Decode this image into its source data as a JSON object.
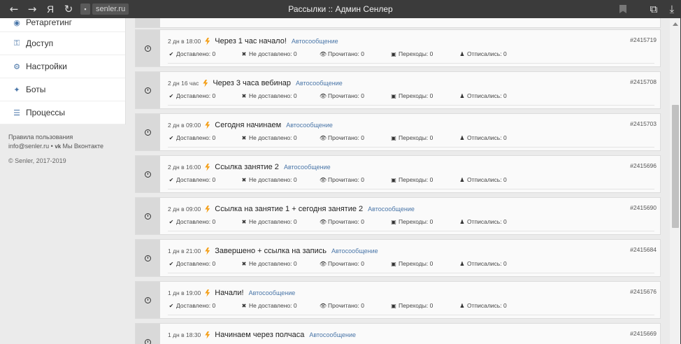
{
  "titlebar": {
    "back_label": "←",
    "forward_label": "→",
    "yandex_label": "Я",
    "reload_label": "↻",
    "lock_icon": "lock-icon",
    "domain": "senler.ru",
    "page_title": "Рассылки :: Админ Сенлер",
    "bookmark_icon": "bookmark-icon",
    "translate_label": "⧉",
    "download_label": "⤓"
  },
  "sidebar": {
    "items": [
      {
        "label": "Ретаргетинг",
        "icon": "◉"
      },
      {
        "label": "Доступ",
        "icon": "⚿"
      },
      {
        "label": "Настройки",
        "icon": "⚙"
      },
      {
        "label": "Боты",
        "icon": "✦"
      },
      {
        "label": "Процессы",
        "icon": "☰"
      }
    ],
    "footer": {
      "terms": "Правила пользования",
      "email": "info@senler.ru",
      "dot": " • ",
      "vk_icon": "vk-icon",
      "vk": "Мы Вконтакте",
      "copyright": "© Senler, 2017-2019"
    }
  },
  "stat_labels": {
    "delivered": "Доставлено: 0",
    "not_delivered": "Не доставлено: 0",
    "read": "Прочитано: 0",
    "clicks": "Переходы: 0",
    "unsubscribed": "Отписались: 0"
  },
  "stat_icons": {
    "delivered": "✔",
    "not_delivered": "✖",
    "read": "👁",
    "clicks": "▣",
    "unsubscribed": "♟"
  },
  "messages": [
    {
      "time": "2 дн в 18:00",
      "name": "Через 1 час начало!",
      "type": "Автосообщение",
      "id": "#2415719"
    },
    {
      "time": "2 дн 16 час",
      "name": "Через 3 часа вебинар",
      "type": "Автосообщение",
      "id": "#2415708"
    },
    {
      "time": "2 дн в 09:00",
      "name": "Сегодня начинаем",
      "type": "Автосообщение",
      "id": "#2415703"
    },
    {
      "time": "2 дн в 16:00",
      "name": "Ссылка занятие 2",
      "type": "Автосообщение",
      "id": "#2415696"
    },
    {
      "time": "2 дн в 09:00",
      "name": "Ссылка на занятие 1 + сегодня занятие 2",
      "type": "Автосообщение",
      "id": "#2415690"
    },
    {
      "time": "1 дн в 21:00",
      "name": "Завершено + ссылка на запись",
      "type": "Автосообщение",
      "id": "#2415684"
    },
    {
      "time": "1 дн в 19:00",
      "name": "Начали!",
      "type": "Автосообщение",
      "id": "#2415676"
    },
    {
      "time": "1 дн в 18:30",
      "name": "Начинаем через полчаса",
      "type": "Автосообщение",
      "id": "#2415669"
    }
  ],
  "colors": {
    "accent": "#4a76a8",
    "bolt": "#f4a01a",
    "titlebar": "#3b3b3b"
  }
}
